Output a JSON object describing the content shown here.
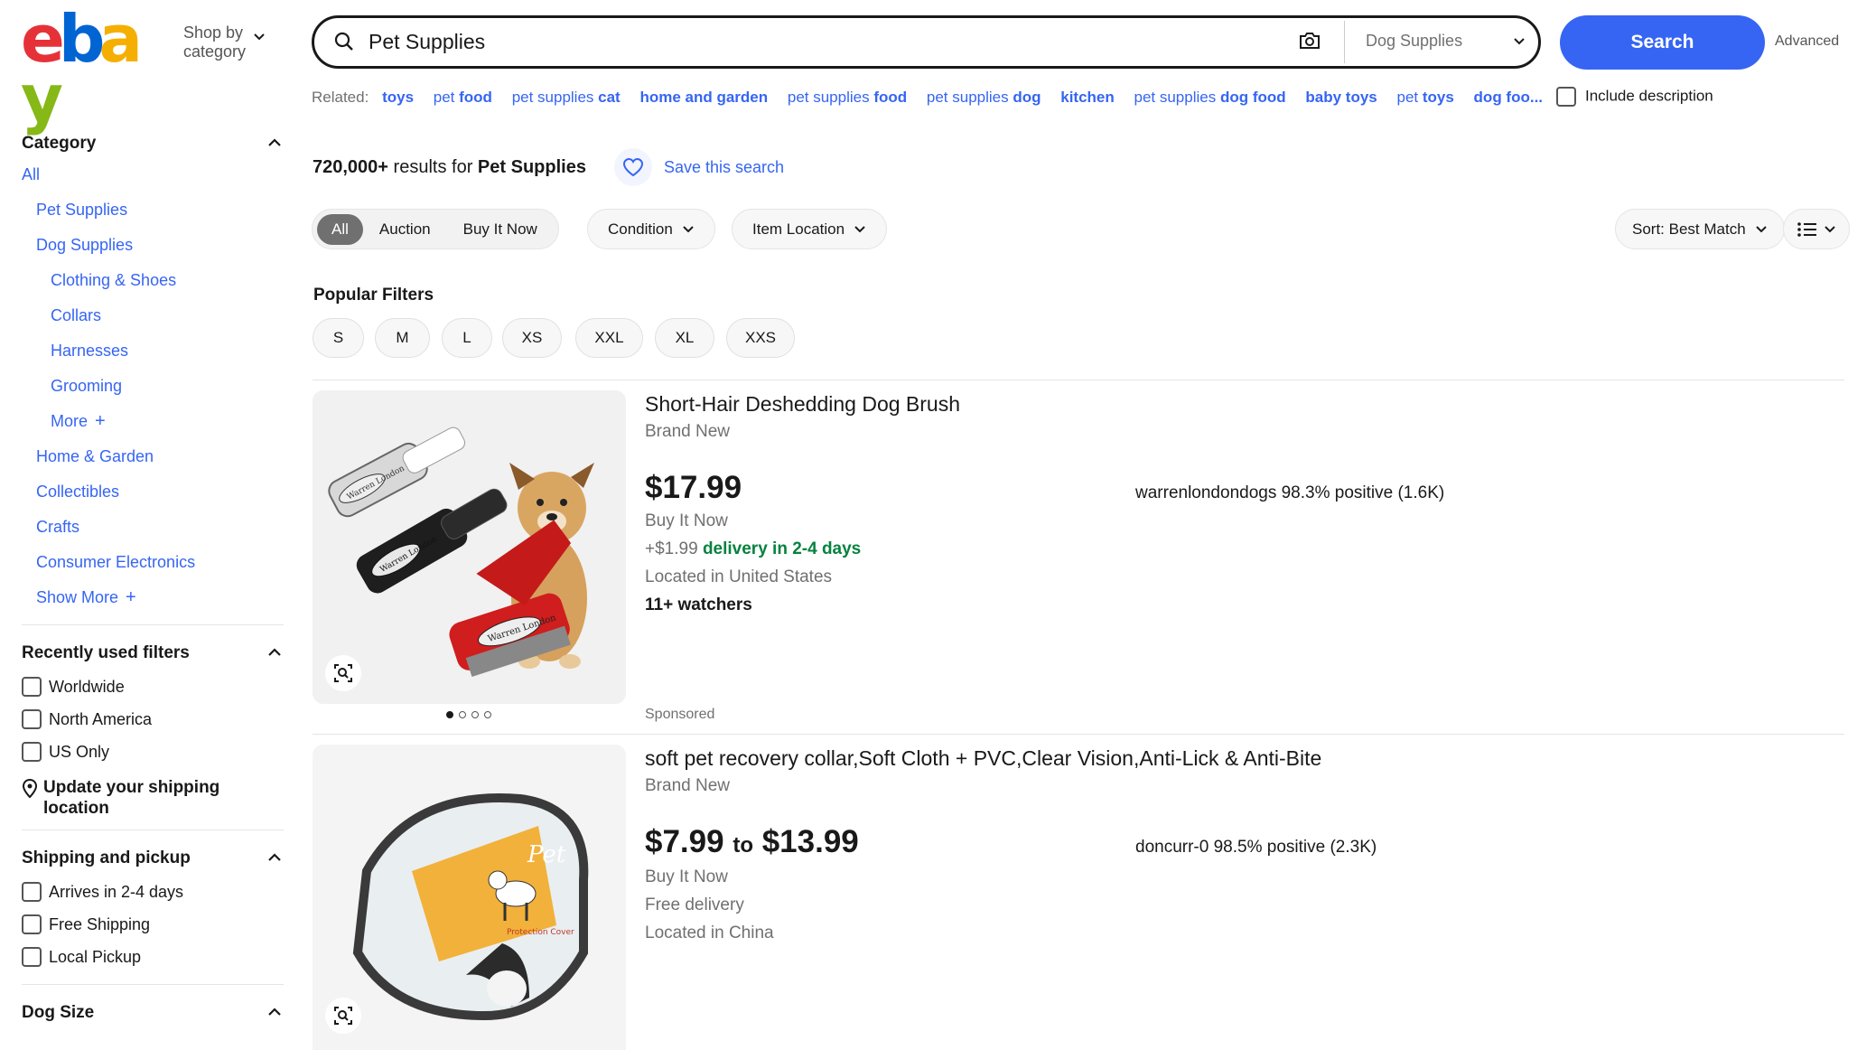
{
  "header": {
    "logo_letters": [
      "e",
      "b",
      "a",
      "y"
    ],
    "logo_colors": [
      "#e53238",
      "#0064d2",
      "#f5af02",
      "#86b817"
    ],
    "shop_by_line1": "Shop by",
    "shop_by_line2": "category",
    "search_value": "Pet Supplies",
    "category_select": "Dog Supplies",
    "search_button": "Search",
    "advanced": "Advanced"
  },
  "related": {
    "label": "Related:",
    "items": [
      {
        "plain": "",
        "bold": "toys"
      },
      {
        "plain": "pet ",
        "bold": "food"
      },
      {
        "plain": "pet supplies ",
        "bold": "cat"
      },
      {
        "plain": "",
        "bold": "home and garden"
      },
      {
        "plain": "pet supplies ",
        "bold": "food"
      },
      {
        "plain": "pet supplies ",
        "bold": "dog"
      },
      {
        "plain": "",
        "bold": "kitchen"
      },
      {
        "plain": "pet supplies ",
        "bold": "dog food"
      },
      {
        "plain": "",
        "bold": "baby toys"
      },
      {
        "plain": "pet ",
        "bold": "toys"
      },
      {
        "plain": "",
        "bold": "dog foo..."
      }
    ],
    "include_description": "Include description"
  },
  "sidebar": {
    "category_title": "Category",
    "categories": [
      {
        "label": "All",
        "level": 0
      },
      {
        "label": "Pet Supplies",
        "level": 1
      },
      {
        "label": "Dog Supplies",
        "level": 1
      },
      {
        "label": "Clothing & Shoes",
        "level": 2
      },
      {
        "label": "Collars",
        "level": 2
      },
      {
        "label": "Harnesses",
        "level": 2
      },
      {
        "label": "Grooming",
        "level": 2
      },
      {
        "label": "More",
        "level": 2,
        "plus": true
      },
      {
        "label": "Home & Garden",
        "level": 1
      },
      {
        "label": "Collectibles",
        "level": 1
      },
      {
        "label": "Crafts",
        "level": 1
      },
      {
        "label": "Consumer Electronics",
        "level": 1
      },
      {
        "label": "Show More",
        "level": 1,
        "plus": true
      }
    ],
    "recent_title": "Recently used filters",
    "recent": [
      "Worldwide",
      "North America",
      "US Only"
    ],
    "update_shipping": "Update your shipping location",
    "shipping_title": "Shipping and pickup",
    "shipping": [
      "Arrives in 2-4 days",
      "Free Shipping",
      "Local Pickup"
    ],
    "dog_size_title": "Dog Size"
  },
  "results": {
    "count": "720,000+",
    "count_suffix": "results for",
    "query": "Pet Supplies",
    "save_search": "Save this search"
  },
  "filters": {
    "segments": [
      "All",
      "Auction",
      "Buy It Now"
    ],
    "condition": "Condition",
    "item_location": "Item Location",
    "sort": "Sort: Best Match"
  },
  "popular": {
    "title": "Popular Filters",
    "sizes": [
      "S",
      "M",
      "L",
      "XS",
      "XXL",
      "XL",
      "XXS"
    ]
  },
  "listings": [
    {
      "title": "Short-Hair Deshedding Dog Brush",
      "condition": "Brand New",
      "price": "$17.99",
      "buy_format": "Buy It Now",
      "shipping_cost": "+$1.99",
      "shipping_delivery": "delivery in 2-4 days",
      "location": "Located in United States",
      "watchers": "11+ watchers",
      "seller": "warrenlondondogs 98.3% positive (1.6K)",
      "sponsored": "Sponsored",
      "image_icon": "dog-brush-product-image",
      "brush_brand": "Warren London"
    },
    {
      "title": "soft pet recovery collar,Soft Cloth + PVC,Clear Vision,Anti-Lick & Anti-Bite",
      "condition": "Brand New",
      "price_low": "$7.99",
      "price_to": "to",
      "price_high": "$13.99",
      "buy_format": "Buy It Now",
      "shipping": "Free delivery",
      "location": "Located in China",
      "seller": "doncurr-0 98.5% positive (2.3K)",
      "image_icon": "recovery-cone-product-image",
      "cone_label_title": "Pet",
      "cone_label_sub": "Protection Cover"
    }
  ]
}
